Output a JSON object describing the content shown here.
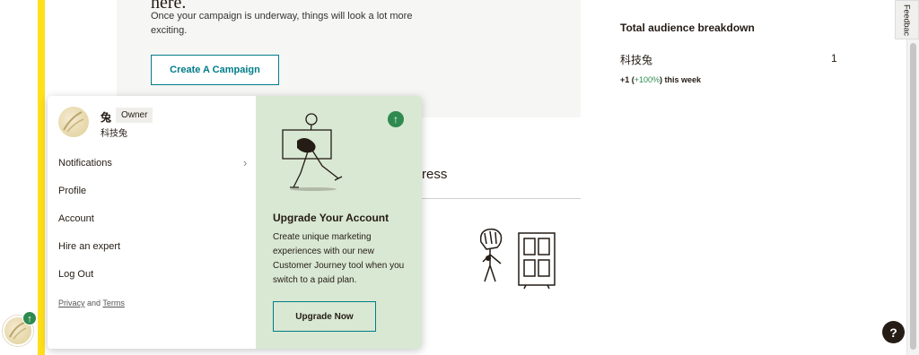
{
  "empty_state": {
    "heading": "here.",
    "text": "Once your campaign is underway, things will look a lot more exciting.",
    "create_button": "Create A Campaign"
  },
  "progress": {
    "title_fragment": "ress"
  },
  "audience": {
    "title": "Total audience breakdown",
    "items": [
      {
        "name": "科技兔",
        "count": "1"
      }
    ],
    "change_prefix": "+1 (",
    "change_pct": "+100%",
    "change_suffix": ") this week"
  },
  "feedback": {
    "label": "Feedbac"
  },
  "help": {
    "label": "?"
  },
  "rail": {
    "badge_icon": "↑"
  },
  "account_menu": {
    "name": "兔",
    "role": "Owner",
    "sub": "科技兔",
    "items": [
      {
        "label": "Notifications"
      },
      {
        "label": "Profile"
      },
      {
        "label": "Account"
      },
      {
        "label": "Hire an expert"
      },
      {
        "label": "Log Out"
      }
    ],
    "chevron": "›",
    "legal_privacy": "Privacy",
    "legal_and": " and ",
    "legal_terms": "Terms"
  },
  "upgrade": {
    "badge_icon": "↑",
    "title": "Upgrade Your Account",
    "text": "Create unique marketing experiences with our new Customer Journey tool when you switch to a paid plan.",
    "button": "Upgrade Now"
  },
  "colors": {
    "accent_yellow": "#ffe01b",
    "teal": "#007c89",
    "green": "#2f8a4f",
    "upgrade_bg": "#d9e8d2"
  }
}
